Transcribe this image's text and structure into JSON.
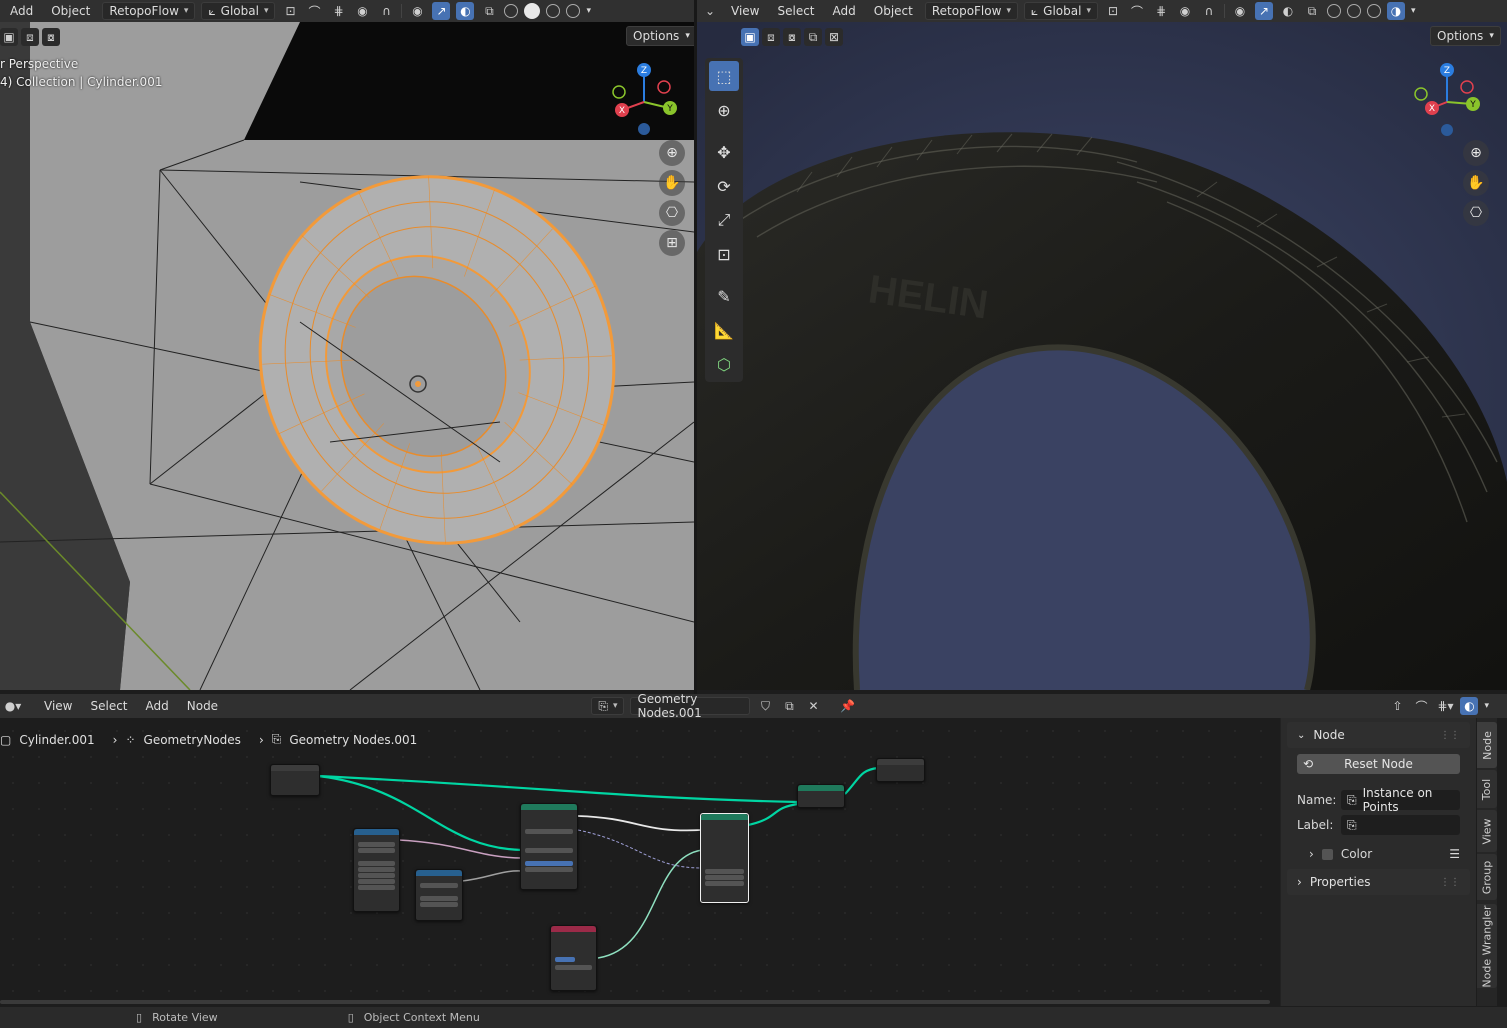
{
  "left_header": {
    "menus": [
      "Add",
      "Object"
    ],
    "addon_dropdown": "RetopoFlow",
    "transform_orientation": "Global"
  },
  "right_header": {
    "menus": [
      "View",
      "Select",
      "Add",
      "Object"
    ],
    "addon_dropdown": "RetopoFlow",
    "transform_orientation": "Global"
  },
  "left_viewport": {
    "options_label": "Options",
    "view_name": "r Perspective",
    "collection_info": "4) Collection | Cylinder.001",
    "gizmo": {
      "z": "Z",
      "x": "X",
      "y": "Y"
    }
  },
  "right_viewport": {
    "options_label": "Options",
    "gizmo": {
      "z": "Z",
      "x": "X",
      "y": "Y"
    }
  },
  "node_editor": {
    "menus": [
      "View",
      "Select",
      "Add",
      "Node"
    ],
    "node_tree_name": "Geometry Nodes.001",
    "breadcrumb": [
      "Cylinder.001",
      "GeometryNodes",
      "Geometry Nodes.001"
    ]
  },
  "node_panel": {
    "section_title": "Node",
    "reset_button": "Reset Node",
    "name_label": "Name:",
    "name_value": "Instance on Points",
    "label_label": "Label:",
    "label_value": "",
    "color_label": "Color",
    "properties_label": "Properties"
  },
  "side_tabs": [
    "Node",
    "Tool",
    "View",
    "Group",
    "Node Wrangler"
  ],
  "statusbar": {
    "items": [
      "Rotate View",
      "Object Context Menu"
    ]
  },
  "colors": {
    "header_bg": "#303030",
    "accent_blue": "#4772b3",
    "selection_orange": "#f29a3a",
    "geometry_socket": "#00d6a3"
  }
}
